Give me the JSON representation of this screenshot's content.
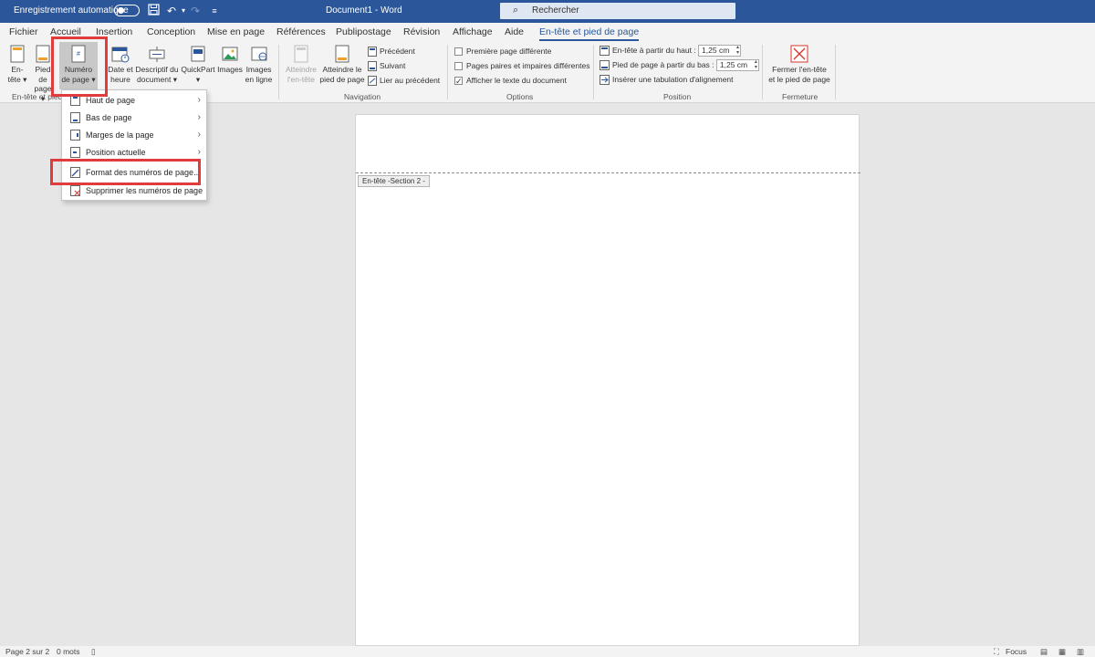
{
  "titlebar": {
    "autosave_label": "Enregistrement automatique",
    "doc_title": "Document1  -  Word",
    "search_placeholder": "Rechercher",
    "toggle_state": "off"
  },
  "tabs": [
    {
      "label": "Fichier"
    },
    {
      "label": "Accueil"
    },
    {
      "label": "Insertion"
    },
    {
      "label": "Conception"
    },
    {
      "label": "Mise en page"
    },
    {
      "label": "Références"
    },
    {
      "label": "Publipostage"
    },
    {
      "label": "Révision"
    },
    {
      "label": "Affichage"
    },
    {
      "label": "Aide"
    },
    {
      "label": "En-tête et pied de page"
    }
  ],
  "ribbon": {
    "group1": {
      "label": "En-tête et pied",
      "entete_1": "En-",
      "entete_2": "tête ▾",
      "pied_1": "Pied de",
      "pied_2": "page ▾",
      "numero_1": "Numéro",
      "numero_2": "de page ▾"
    },
    "group2": {
      "date_1": "Date et",
      "date_2": "heure",
      "desc_1": "Descriptif du",
      "desc_2": "document ▾",
      "quickpart_1": "QuickPart",
      "quickpart_2": "▾",
      "images": "Images",
      "images_en_ligne_1": "Images",
      "images_en_ligne_2": "en ligne"
    },
    "navigation": {
      "label": "Navigation",
      "atteindre_entete_1": "Atteindre",
      "atteindre_entete_2": "l'en-tête",
      "atteindre_pied_1": "Atteindre le",
      "atteindre_pied_2": "pied de page",
      "precedent": "Précédent",
      "suivant": "Suivant",
      "lier": "Lier au précédent"
    },
    "options": {
      "label": "Options",
      "premiere_page": "Première page différente",
      "pages_paires": "Pages paires et impaires différentes",
      "afficher_texte": "Afficher le texte du document"
    },
    "position": {
      "label": "Position",
      "entete_haut": "En-tête à partir du haut :",
      "entete_haut_value": "1,25 cm",
      "pied_bas": "Pied de page à partir du bas :",
      "pied_bas_value": "1,25 cm",
      "tabulation": "Insérer une tabulation d'alignement"
    },
    "fermeture": {
      "label": "Fermeture",
      "fermer_1": "Fermer l'en-tête",
      "fermer_2": "et le pied de page"
    }
  },
  "menu": {
    "items": [
      {
        "label": "Haut de page",
        "submenu": true
      },
      {
        "label": "Bas de page",
        "submenu": true
      },
      {
        "label": "Marges de la page",
        "submenu": true
      },
      {
        "label": "Position actuelle",
        "submenu": true
      },
      {
        "label": "Format des numéros de page...",
        "submenu": false
      },
      {
        "label": "Supprimer les numéros de page",
        "submenu": false
      }
    ]
  },
  "document": {
    "header_tag": "En-tête -Section 2 -"
  },
  "statusbar": {
    "page": "Page 2 sur 2",
    "words": "0 mots",
    "focus": "Focus"
  },
  "colors": {
    "accent": "#2b579a",
    "highlight": "#e03c3c"
  }
}
